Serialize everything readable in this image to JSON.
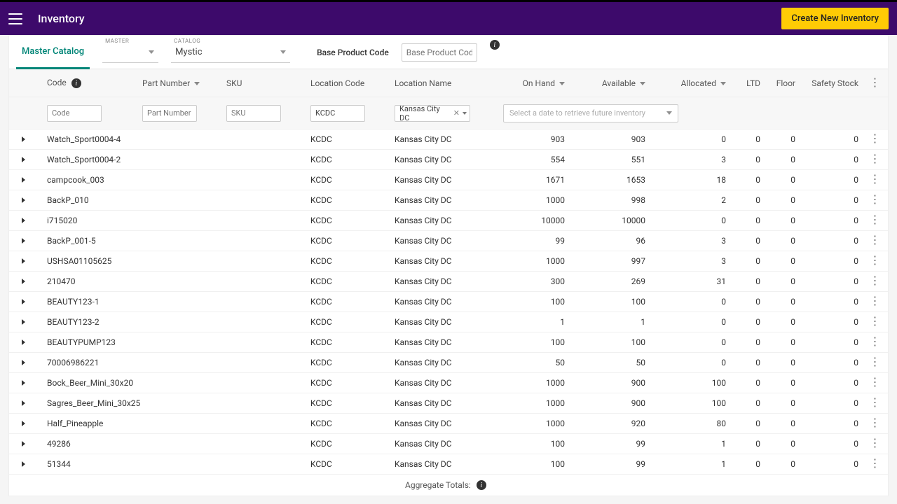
{
  "header": {
    "title": "Inventory",
    "create_label": "Create New Inventory"
  },
  "filters": {
    "tab_label": "Master Catalog",
    "master_label": "MASTER",
    "master_value": "",
    "catalog_label": "CATALOG",
    "catalog_value": "Mystic",
    "bpc_label": "Base Product Code",
    "bpc_placeholder": "Base Product Code"
  },
  "table": {
    "headers": {
      "code": "Code",
      "part": "Part Number",
      "sku": "SKU",
      "loccode": "Location Code",
      "locname": "Location Name",
      "onhand": "On Hand",
      "available": "Available",
      "allocated": "Allocated",
      "ltd": "LTD",
      "floor": "Floor",
      "safety": "Safety Stock"
    },
    "filters": {
      "code_ph": "Code",
      "part_ph": "Part Number",
      "sku_ph": "SKU",
      "loccode_val": "KCDC",
      "locname_val": "Kansas City DC",
      "date_ph": "Select a date to retrieve future inventory"
    },
    "rows": [
      {
        "code": "Watch_Sport0004-4",
        "loccode": "KCDC",
        "locname": "Kansas City DC",
        "onhand": "903",
        "available": "903",
        "allocated": "0",
        "ltd": "0",
        "floor": "0",
        "safety": "0"
      },
      {
        "code": "Watch_Sport0004-2",
        "loccode": "KCDC",
        "locname": "Kansas City DC",
        "onhand": "554",
        "available": "551",
        "allocated": "3",
        "ltd": "0",
        "floor": "0",
        "safety": "0"
      },
      {
        "code": "campcook_003",
        "loccode": "KCDC",
        "locname": "Kansas City DC",
        "onhand": "1671",
        "available": "1653",
        "allocated": "18",
        "ltd": "0",
        "floor": "0",
        "safety": "0"
      },
      {
        "code": "BackP_010",
        "loccode": "KCDC",
        "locname": "Kansas City DC",
        "onhand": "1000",
        "available": "998",
        "allocated": "2",
        "ltd": "0",
        "floor": "0",
        "safety": "0"
      },
      {
        "code": "i715020",
        "loccode": "KCDC",
        "locname": "Kansas City DC",
        "onhand": "10000",
        "available": "10000",
        "allocated": "0",
        "ltd": "0",
        "floor": "0",
        "safety": "0"
      },
      {
        "code": "BackP_001-5",
        "loccode": "KCDC",
        "locname": "Kansas City DC",
        "onhand": "99",
        "available": "96",
        "allocated": "3",
        "ltd": "0",
        "floor": "0",
        "safety": "0"
      },
      {
        "code": "USHSA01105625",
        "loccode": "KCDC",
        "locname": "Kansas City DC",
        "onhand": "1000",
        "available": "997",
        "allocated": "3",
        "ltd": "0",
        "floor": "0",
        "safety": "0"
      },
      {
        "code": "210470",
        "loccode": "KCDC",
        "locname": "Kansas City DC",
        "onhand": "300",
        "available": "269",
        "allocated": "31",
        "ltd": "0",
        "floor": "0",
        "safety": "0"
      },
      {
        "code": "BEAUTY123-1",
        "loccode": "KCDC",
        "locname": "Kansas City DC",
        "onhand": "100",
        "available": "100",
        "allocated": "0",
        "ltd": "0",
        "floor": "0",
        "safety": "0"
      },
      {
        "code": "BEAUTY123-2",
        "loccode": "KCDC",
        "locname": "Kansas City DC",
        "onhand": "1",
        "available": "1",
        "allocated": "0",
        "ltd": "0",
        "floor": "0",
        "safety": "0"
      },
      {
        "code": "BEAUTYPUMP123",
        "loccode": "KCDC",
        "locname": "Kansas City DC",
        "onhand": "100",
        "available": "100",
        "allocated": "0",
        "ltd": "0",
        "floor": "0",
        "safety": "0"
      },
      {
        "code": "70006986221",
        "loccode": "KCDC",
        "locname": "Kansas City DC",
        "onhand": "50",
        "available": "50",
        "allocated": "0",
        "ltd": "0",
        "floor": "0",
        "safety": "0"
      },
      {
        "code": "Bock_Beer_Mini_30x20",
        "loccode": "KCDC",
        "locname": "Kansas City DC",
        "onhand": "1000",
        "available": "900",
        "allocated": "100",
        "ltd": "0",
        "floor": "0",
        "safety": "0"
      },
      {
        "code": "Sagres_Beer_Mini_30x25",
        "loccode": "KCDC",
        "locname": "Kansas City DC",
        "onhand": "1000",
        "available": "900",
        "allocated": "100",
        "ltd": "0",
        "floor": "0",
        "safety": "0"
      },
      {
        "code": "Half_Pineapple",
        "loccode": "KCDC",
        "locname": "Kansas City DC",
        "onhand": "1000",
        "available": "920",
        "allocated": "80",
        "ltd": "0",
        "floor": "0",
        "safety": "0"
      },
      {
        "code": "49286",
        "loccode": "KCDC",
        "locname": "Kansas City DC",
        "onhand": "100",
        "available": "99",
        "allocated": "1",
        "ltd": "0",
        "floor": "0",
        "safety": "0"
      },
      {
        "code": "51344",
        "loccode": "KCDC",
        "locname": "Kansas City DC",
        "onhand": "100",
        "available": "99",
        "allocated": "1",
        "ltd": "0",
        "floor": "0",
        "safety": "0"
      }
    ],
    "aggregate_label": "Aggregate Totals:"
  }
}
